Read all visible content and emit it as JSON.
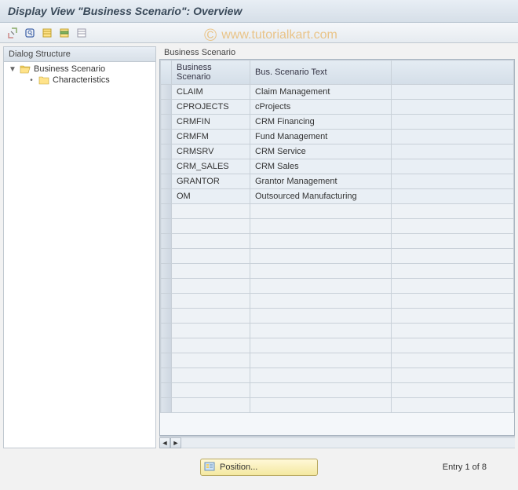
{
  "title": "Display View \"Business Scenario\": Overview",
  "watermark": "www.tutorialkart.com",
  "toolbar": {
    "icons": [
      "display-change-icon",
      "find-icon",
      "select-all-icon",
      "select-block-icon",
      "deselect-all-icon"
    ]
  },
  "tree": {
    "header": "Dialog Structure",
    "root": {
      "label": "Business Scenario",
      "expanded": true
    },
    "child": {
      "label": "Characteristics"
    }
  },
  "table": {
    "title": "Business Scenario",
    "columns": [
      "Business Scenario",
      "Bus. Scenario Text"
    ],
    "rows": [
      {
        "code": "CLAIM",
        "text": "Claim Management"
      },
      {
        "code": "CPROJECTS",
        "text": "cProjects"
      },
      {
        "code": "CRMFIN",
        "text": "CRM Financing"
      },
      {
        "code": "CRMFM",
        "text": "Fund Management"
      },
      {
        "code": "CRMSRV",
        "text": "CRM Service"
      },
      {
        "code": "CRM_SALES",
        "text": "CRM Sales"
      },
      {
        "code": "GRANTOR",
        "text": "Grantor Management"
      },
      {
        "code": "OM",
        "text": "Outsourced Manufacturing"
      }
    ],
    "blank_rows": 14
  },
  "footer": {
    "position_label": "Position...",
    "entry_text": "Entry 1 of 8"
  }
}
